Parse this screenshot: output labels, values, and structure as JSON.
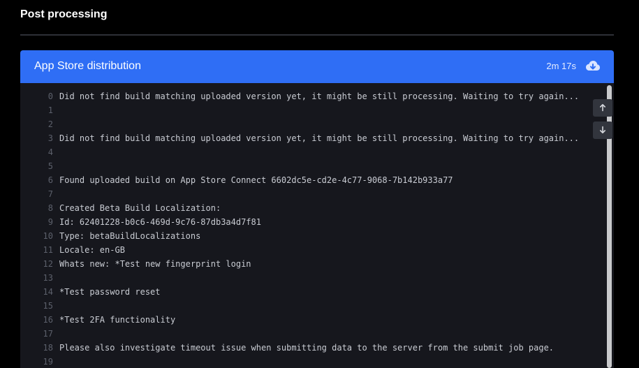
{
  "section": {
    "title": "Post processing"
  },
  "step": {
    "title": "App Store distribution",
    "duration": "2m 17s",
    "download_icon": "cloud-download-icon",
    "accent_color": "#2f6ef5"
  },
  "log": {
    "lines": [
      {
        "num": "0",
        "text": "Did not find build matching uploaded version yet, it might be still processing. Waiting to try again..."
      },
      {
        "num": "1",
        "text": ""
      },
      {
        "num": "2",
        "text": ""
      },
      {
        "num": "3",
        "text": "Did not find build matching uploaded version yet, it might be still processing. Waiting to try again..."
      },
      {
        "num": "4",
        "text": ""
      },
      {
        "num": "5",
        "text": ""
      },
      {
        "num": "6",
        "text": "Found uploaded build on App Store Connect 6602dc5e-cd2e-4c77-9068-7b142b933a77"
      },
      {
        "num": "7",
        "text": ""
      },
      {
        "num": "8",
        "text": "Created Beta Build Localization:"
      },
      {
        "num": "9",
        "text": "Id: 62401228-b0c6-469d-9c76-87db3a4d7f81"
      },
      {
        "num": "10",
        "text": "Type: betaBuildLocalizations"
      },
      {
        "num": "11",
        "text": "Locale: en-GB"
      },
      {
        "num": "12",
        "text": "Whats new: *Test new fingerprint login"
      },
      {
        "num": "13",
        "text": ""
      },
      {
        "num": "14",
        "text": "*Test password reset"
      },
      {
        "num": "15",
        "text": ""
      },
      {
        "num": "16",
        "text": "*Test 2FA functionality"
      },
      {
        "num": "17",
        "text": ""
      },
      {
        "num": "18",
        "text": "Please also investigate timeout issue when submitting data to the server from the submit job page."
      },
      {
        "num": "19",
        "text": ""
      }
    ],
    "scroll_up_icon": "arrow-up-icon",
    "scroll_down_icon": "arrow-down-icon"
  }
}
